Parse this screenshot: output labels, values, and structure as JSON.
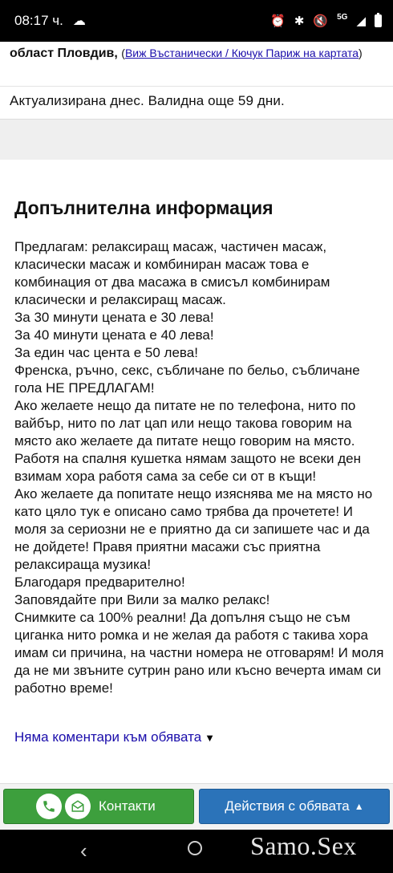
{
  "status_bar": {
    "time": "08:17 ч.",
    "network": "5G"
  },
  "listing": {
    "region": "област Пловдив,",
    "map_link": "Виж Въстанически / Кючук Париж на картата",
    "updated": "Актуализирана днес. Валидна още 59 дни."
  },
  "info": {
    "title": "Допълнителна информация",
    "text": "Предлагам: релаксиращ масаж, частичен масаж, класически масаж и комбиниран масаж това е комбинация от два масажа в смисъл комбинирам класически и релаксиращ масаж.\nЗа 30 минути цената е 30 лева!\nЗа 40 минути цената е 40 лева!\nЗа един час цента е 50 лева!\nФренска, ръчно, секс, събличане по бельо, събличане гола НЕ ПРЕДЛАГАМ!\nАко желаете нещо да питате не по телефона, нито по вайбър, нито по лат цап или нещо такова говорим на място ако желаете да питате нещо говорим на място. Работя на спалня кушетка нямам защото не всеки ден взимам хора работя сама за себе си от в къщи!\nАко желаете да попитате нещо изяснява ме на място но като цяло тук е описано само трябва да прочетете! И моля за сериозни не е приятно да си запишете час и да не дойдете! Правя приятни масажи със приятна релаксираща музика!\nБлагодаря предварително!\nЗаповядайте при Вили за малко релакс!\nСнимките са 100% реални! Да допълня също не съм циганка нито ромка и не желая да работя с такива хора имам си причина, на частни номера не отговарям! И моля да не ми звъните сутрин рано или късно вечерта имам си работно време!",
    "comments_link": "Няма коментари към обявата"
  },
  "actions": {
    "contacts_label": "Контакти",
    "actions_label": "Действия с обявата"
  },
  "watermark": "Samo.Sex",
  "colors": {
    "contacts_green": "#3d9f3d",
    "actions_blue": "#2b73b9",
    "link_blue": "#1a0dab"
  }
}
